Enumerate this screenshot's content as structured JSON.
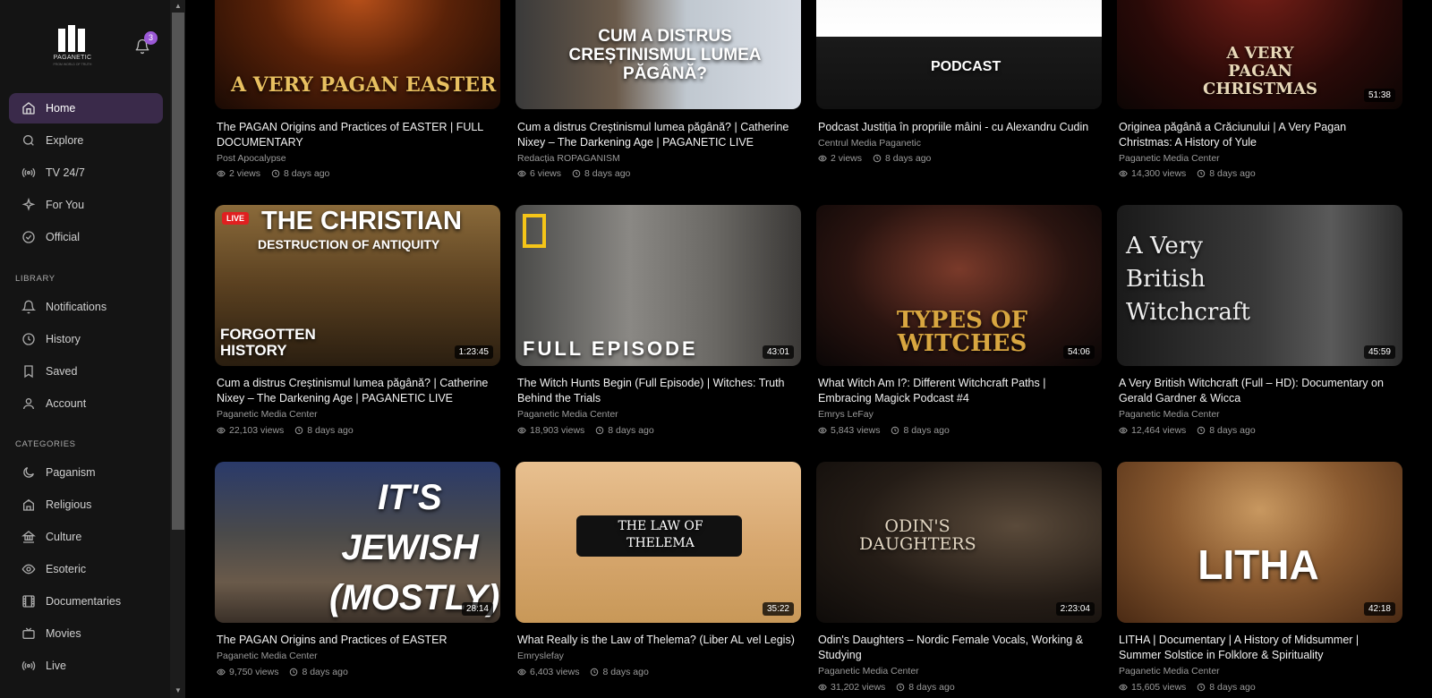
{
  "brand": {
    "name": "PAGANETIC",
    "tagline": "FROM WORLD OF TRUTH"
  },
  "notifications": {
    "count": "3"
  },
  "nav": [
    {
      "label": "Home",
      "icon": "home-icon"
    },
    {
      "label": "Explore",
      "icon": "search-icon"
    },
    {
      "label": "TV 24/7",
      "icon": "broadcast-icon"
    },
    {
      "label": "For You",
      "icon": "sparkle-icon"
    },
    {
      "label": "Official",
      "icon": "check-circle-icon"
    }
  ],
  "library": {
    "heading": "LIBRARY",
    "items": [
      {
        "label": "Notifications",
        "icon": "bell-icon"
      },
      {
        "label": "History",
        "icon": "clock-icon"
      },
      {
        "label": "Saved",
        "icon": "bookmark-icon"
      },
      {
        "label": "Account",
        "icon": "user-icon"
      }
    ]
  },
  "categories": {
    "heading": "CATEGORIES",
    "items": [
      {
        "label": "Paganism",
        "icon": "moon-icon"
      },
      {
        "label": "Religious",
        "icon": "temple-icon"
      },
      {
        "label": "Culture",
        "icon": "landmark-icon"
      },
      {
        "label": "Esoteric",
        "icon": "eye-icon"
      },
      {
        "label": "Documentaries",
        "icon": "film-icon"
      },
      {
        "label": "Movies",
        "icon": "tv-icon"
      },
      {
        "label": "Live",
        "icon": "broadcast-icon"
      }
    ]
  },
  "videos": [
    {
      "title": "The PAGAN Origins and Practices of EASTER | FULL DOCUMENTARY",
      "author": "Post Apocalypse",
      "views": "2 views",
      "ago": "8 days ago",
      "duration": "",
      "thumb_text": "A VERY PAGAN EASTER"
    },
    {
      "title": "Cum a distrus Creștinismul lumea păgână? | Catherine Nixey – The Darkening Age | PAGANETIC LIVE",
      "author": "Redacția ROPAGANISM",
      "views": "6 views",
      "ago": "8 days ago",
      "duration": "",
      "thumb_text": "CUM A DISTRUS CREȘTINISMUL LUMEA PĂGÂNĂ?"
    },
    {
      "title": "Podcast Justiția în propriile mâini - cu Alexandru Cudin",
      "author": "Centrul Media Paganetic",
      "views": "2 views",
      "ago": "8 days ago",
      "duration": "",
      "thumb_text": "PODCAST"
    },
    {
      "title": "Originea păgână a Crăciunului | A Very Pagan Christmas: A History of Yule",
      "author": "Paganetic Media Center",
      "views": "14,300 views",
      "ago": "8 days ago",
      "duration": "51:38",
      "thumb_text": "A VERY PAGAN CHRISTMAS"
    },
    {
      "title": "Cum a distrus Creștinismul lumea păgână? | Catherine Nixey – The Darkening Age | PAGANETIC LIVE",
      "author": "Paganetic Media Center",
      "views": "22,103 views",
      "ago": "8 days ago",
      "duration": "1:23:45",
      "live": "LIVE",
      "thumb_text": "THE CHRISTIAN",
      "thumb_text2": "DESTRUCTION OF ANTIQUITY",
      "thumb_text3": "FORGOTTEN HISTORY"
    },
    {
      "title": "The Witch Hunts Begin (Full Episode) | Witches: Truth Behind the Trials",
      "author": "Paganetic Media Center",
      "views": "18,903 views",
      "ago": "8 days ago",
      "duration": "43:01",
      "thumb_text": "FULL EPISODE"
    },
    {
      "title": "What Witch Am I?: Different Witchcraft Paths | Embracing Magick Podcast #4",
      "author": "Emrys LeFay",
      "views": "5,843 views",
      "ago": "8 days ago",
      "duration": "54:06",
      "thumb_text": "TYPES OF WITCHES"
    },
    {
      "title": "A Very British Witchcraft (Full – HD): Documentary on Gerald Gardner & Wicca",
      "author": "Paganetic Media Center",
      "views": "12,464 views",
      "ago": "8 days ago",
      "duration": "45:59",
      "thumb_text": "A Very British Witchcraft"
    },
    {
      "title": "The PAGAN Origins and Practices of EASTER",
      "author": "Paganetic Media Center",
      "views": "9,750 views",
      "ago": "8 days ago",
      "duration": "28:14",
      "thumb_text": "IT'S JEWISH (MOSTLY)"
    },
    {
      "title": "What Really is the Law of Thelema? (Liber AL vel Legis)",
      "author": "Emryslefay",
      "views": "6,403 views",
      "ago": "8 days ago",
      "duration": "35:22",
      "thumb_text": "THE LAW OF THELEMA"
    },
    {
      "title": "Odin's Daughters – Nordic Female Vocals, Working & Studying",
      "author": "Paganetic Media Center",
      "views": "31,202 views",
      "ago": "8 days ago",
      "duration": "2:23:04",
      "thumb_text": "ODIN'S DAUGHTERS"
    },
    {
      "title": "LITHA | Documentary | A History of Midsummer | Summer Solstice in Folklore & Spirituality",
      "author": "Paganetic Media Center",
      "views": "15,605 views",
      "ago": "8 days ago",
      "duration": "42:18",
      "thumb_text": "LITHA"
    }
  ]
}
